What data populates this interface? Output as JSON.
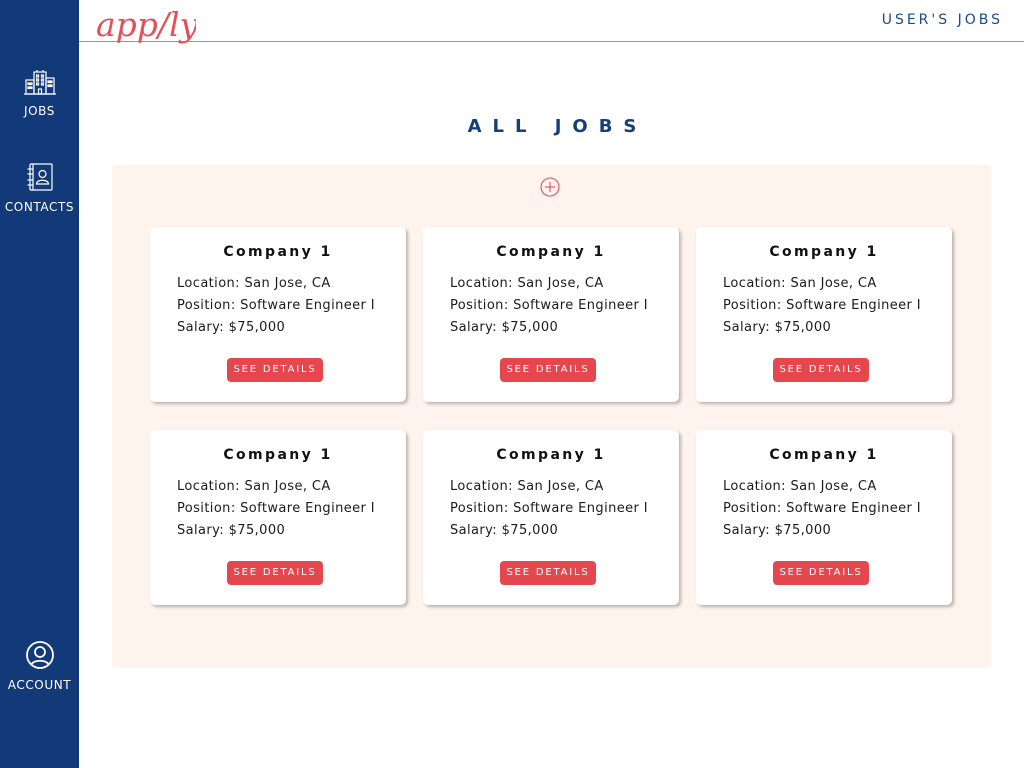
{
  "sidebar": {
    "items": [
      {
        "label": "JOBS",
        "icon": "buildings-icon"
      },
      {
        "label": "CONTACTS",
        "icon": "contact-book-icon"
      },
      {
        "label": "ACCOUNT",
        "icon": "user-circle-icon"
      }
    ]
  },
  "header": {
    "logo_text": "app/ly",
    "user_jobs_label": "USER'S JOBS"
  },
  "main": {
    "title": "ALL JOBS",
    "add_icon": "plus-circle-icon",
    "jobs": [
      {
        "company": "Company 1",
        "location": "Location: San Jose, CA",
        "position": "Position: Software Engineer I",
        "salary": "Salary: $75,000",
        "button": "SEE DETAILS"
      },
      {
        "company": "Company 1",
        "location": "Location: San Jose, CA",
        "position": "Position: Software Engineer I",
        "salary": "Salary: $75,000",
        "button": "SEE DETAILS"
      },
      {
        "company": "Company 1",
        "location": "Location: San Jose, CA",
        "position": "Position: Software Engineer I",
        "salary": "Salary: $75,000",
        "button": "SEE DETAILS"
      },
      {
        "company": "Company 1",
        "location": "Location: San Jose, CA",
        "position": "Position: Software Engineer I",
        "salary": "Salary: $75,000",
        "button": "SEE DETAILS"
      },
      {
        "company": "Company 1",
        "location": "Location: San Jose, CA",
        "position": "Position: Software Engineer I",
        "salary": "Salary: $75,000",
        "button": "SEE DETAILS"
      },
      {
        "company": "Company 1",
        "location": "Location: San Jose, CA",
        "position": "Position: Software Engineer I",
        "salary": "Salary: $75,000",
        "button": "SEE DETAILS"
      }
    ]
  },
  "colors": {
    "sidebar": "#133a78",
    "accent": "#e5474f",
    "panel": "#fff3ee",
    "title": "#153f76"
  }
}
